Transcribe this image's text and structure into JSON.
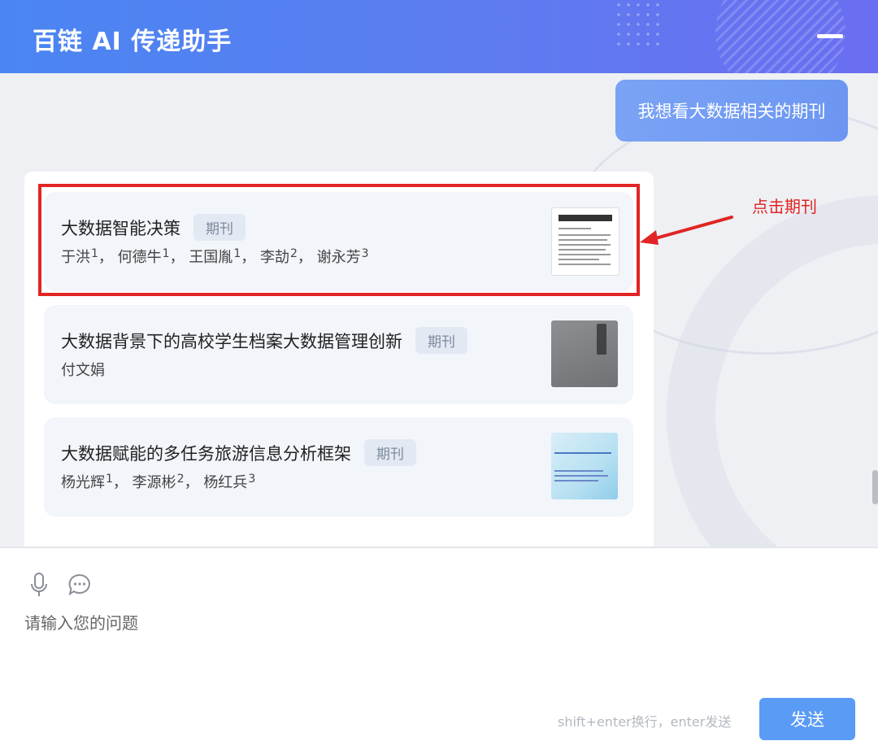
{
  "header": {
    "title": "百链 AI 传递助手"
  },
  "chat": {
    "user_message": "我想看大数据相关的期刊",
    "results": [
      {
        "title": "大数据智能决策",
        "tag": "期刊",
        "authors": [
          {
            "name": "于洪",
            "sup": "1"
          },
          {
            "name": "何德牛",
            "sup": "1"
          },
          {
            "name": "王国胤",
            "sup": "1"
          },
          {
            "name": "李劼",
            "sup": "2"
          },
          {
            "name": "谢永芳",
            "sup": "3"
          }
        ],
        "cover": "journal-cover-1"
      },
      {
        "title": "大数据背景下的高校学生档案大数据管理创新",
        "tag": "期刊",
        "authors": [
          {
            "name": "付文娟",
            "sup": ""
          }
        ],
        "cover": "journal-cover-2"
      },
      {
        "title": "大数据赋能的多任务旅游信息分析框架",
        "tag": "期刊",
        "authors": [
          {
            "name": "杨光辉",
            "sup": "1"
          },
          {
            "name": "李源彬",
            "sup": "2"
          },
          {
            "name": "杨红兵",
            "sup": "3"
          }
        ],
        "cover": "journal-cover-3"
      }
    ]
  },
  "annotation": {
    "text": "点击期刊",
    "color": "#e12424"
  },
  "input": {
    "placeholder": "请输入您的问题",
    "hint": "shift+enter换行，enter发送",
    "send_label": "发送"
  },
  "colors": {
    "accent": "#5a9bf6",
    "header_start": "#4a86f2",
    "header_end": "#6a6ef0"
  }
}
